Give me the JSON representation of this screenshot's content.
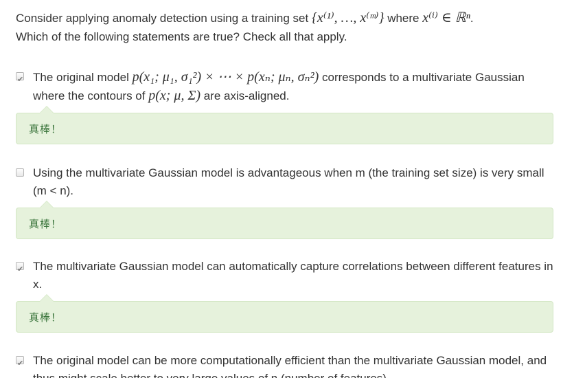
{
  "question": {
    "part1": "Consider applying anomaly detection using a training set ",
    "set_math": "{x⁽¹⁾, …, x⁽ᵐ⁾}",
    "part2": " where ",
    "member_math": "x⁽ⁱ⁾ ∈ ℝⁿ",
    "part3": ".",
    "line2": "Which of the following statements are true? Check all that apply."
  },
  "options": [
    {
      "checked": true,
      "text_a": "The original model ",
      "math_a": "p(x₁; μ₁, σ₁²) × ⋯ × p(xₙ; μₙ, σₙ²)",
      "text_b": " corresponds to a multivariate Gaussian where the contours of ",
      "math_b": "p(x; μ, Σ)",
      "text_c": " are axis-aligned.",
      "feedback": "真棒！"
    },
    {
      "checked": false,
      "text": "Using the multivariate Gaussian model is advantageous when m (the training set size) is very small (m < n).",
      "feedback": "真棒！"
    },
    {
      "checked": true,
      "text": "The multivariate Gaussian model can automatically capture correlations between different features in x.",
      "feedback": "真棒！"
    },
    {
      "checked": true,
      "text": "The original model can be more computationally efficient than the multivariate Gaussian model, and thus might scale better to very large values of n (number of features)."
    }
  ],
  "checkmark_glyph": "✔",
  "colors": {
    "feedback_bg": "#e6f2dc",
    "feedback_border": "#d3e7c4",
    "feedback_text": "#3c763d",
    "body_text": "#333333"
  }
}
